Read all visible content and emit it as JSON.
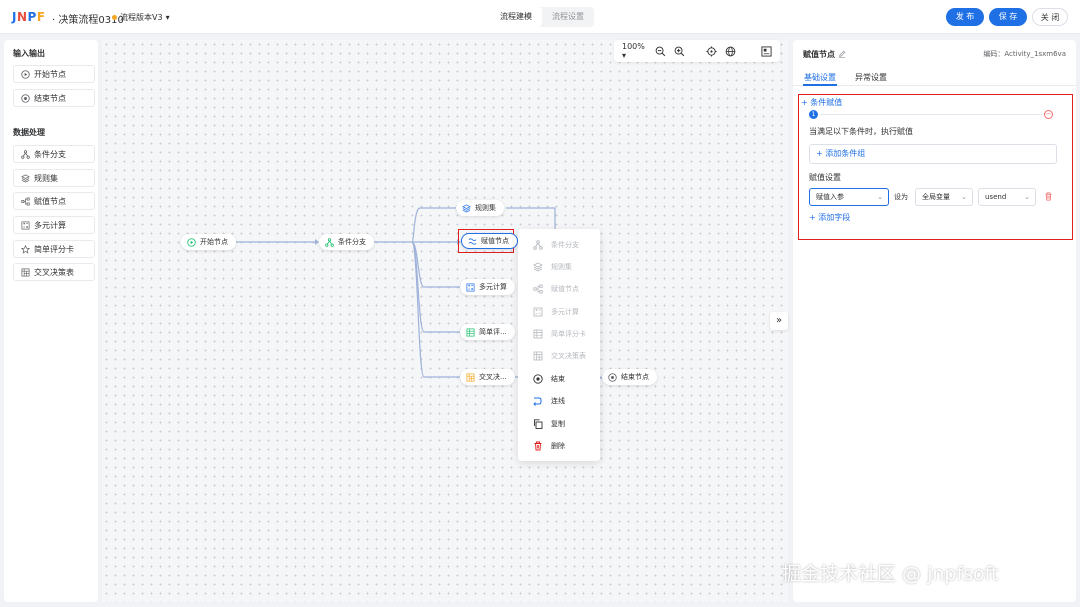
{
  "header": {
    "logo": {
      "j": "J",
      "n": "N",
      "p": "P",
      "f": "F"
    },
    "title": "· 决策流程0310",
    "version_label": "流程版本V3",
    "version_arrow": "▾",
    "tabs": [
      "流程建模",
      "流程设置"
    ],
    "active_tab": 0,
    "buttons": {
      "publish": "发 布",
      "save": "保 存",
      "close": "关 闭"
    }
  },
  "left_panel": {
    "sections": [
      {
        "title": "输入输出",
        "items": [
          {
            "label": "开始节点",
            "icon": "play-circle-icon"
          },
          {
            "label": "结束节点",
            "icon": "stop-circle-icon"
          }
        ]
      },
      {
        "title": "数据处理",
        "items": [
          {
            "label": "条件分支",
            "icon": "branch-icon"
          },
          {
            "label": "规则集",
            "icon": "layers-icon"
          },
          {
            "label": "赋值节点",
            "icon": "assign-icon"
          },
          {
            "label": "多元计算",
            "icon": "calculator-icon"
          },
          {
            "label": "简单评分卡",
            "icon": "star-icon"
          },
          {
            "label": "交叉决策表",
            "icon": "table-icon"
          }
        ]
      }
    ]
  },
  "toolbar": {
    "zoom": "100%",
    "zoom_arrow": "▾"
  },
  "canvas": {
    "nodes": {
      "start": "开始节点",
      "branch": "条件分支",
      "ruleset": "规则集",
      "assign": "赋值节点",
      "multicalc": "多元计算",
      "scorecard": "简单评...",
      "crosstable": "交叉决...",
      "end": "结束节点"
    },
    "context_menu": {
      "disabled_items": [
        "条件分支",
        "规则集",
        "赋值节点",
        "多元计算",
        "简单评分卡",
        "交叉决策表"
      ],
      "enabled_items": [
        "结束",
        "连线",
        "复制",
        "删除"
      ]
    },
    "collapse_label": "»"
  },
  "right_panel": {
    "title": "赋值节点",
    "code": "编码：Activity_1sxm6va",
    "tabs": [
      "基础设置",
      "异常设置"
    ],
    "active_tab": 0,
    "condition_add": "+ 条件赋值",
    "step_number": "1",
    "condition_text": "当满足以下条件时，执行赋值",
    "add_condition_group": "+ 添加条件组",
    "assign_settings": "赋值设置",
    "assign_target": "赋值入参",
    "set_as": "设为",
    "var_type": "全局变量",
    "var_value": "usend",
    "add_field": "+ 添加字段"
  },
  "watermark": "掘金技术社区 @ jnpfsoft",
  "colors": {
    "primary": "#1f6fe5",
    "danger": "#e02020",
    "start_green": "#19be6b"
  }
}
